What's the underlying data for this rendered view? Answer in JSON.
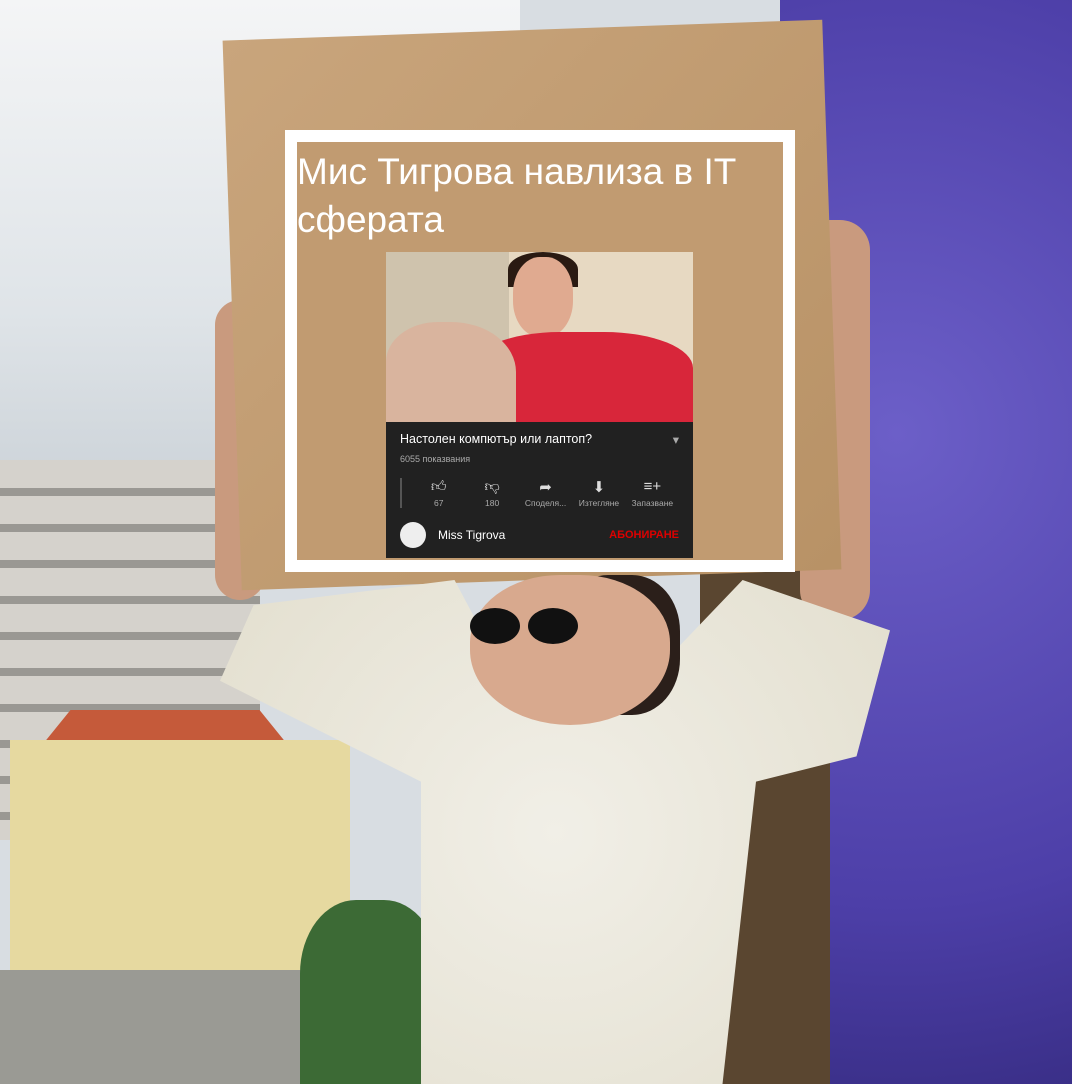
{
  "meme": {
    "caption": "Мис Тигрова навлиза в IT сферата"
  },
  "video": {
    "title": "Настолен компютър или лаптоп?",
    "views": "6055 показвания",
    "actions": [
      {
        "icon": "thumbs-up-icon",
        "label": "67"
      },
      {
        "icon": "thumbs-down-icon",
        "label": "180"
      },
      {
        "icon": "share-icon",
        "label": "Споделя..."
      },
      {
        "icon": "download-icon",
        "label": "Изтегляне"
      },
      {
        "icon": "playlist-add-icon",
        "label": "Запазване"
      }
    ],
    "channel": "Miss Tigrova",
    "subscribe": "АБОНИРАНЕ"
  },
  "colors": {
    "accent": "#d8263a",
    "panel": "#212121",
    "wall": "#4d3fa8"
  }
}
